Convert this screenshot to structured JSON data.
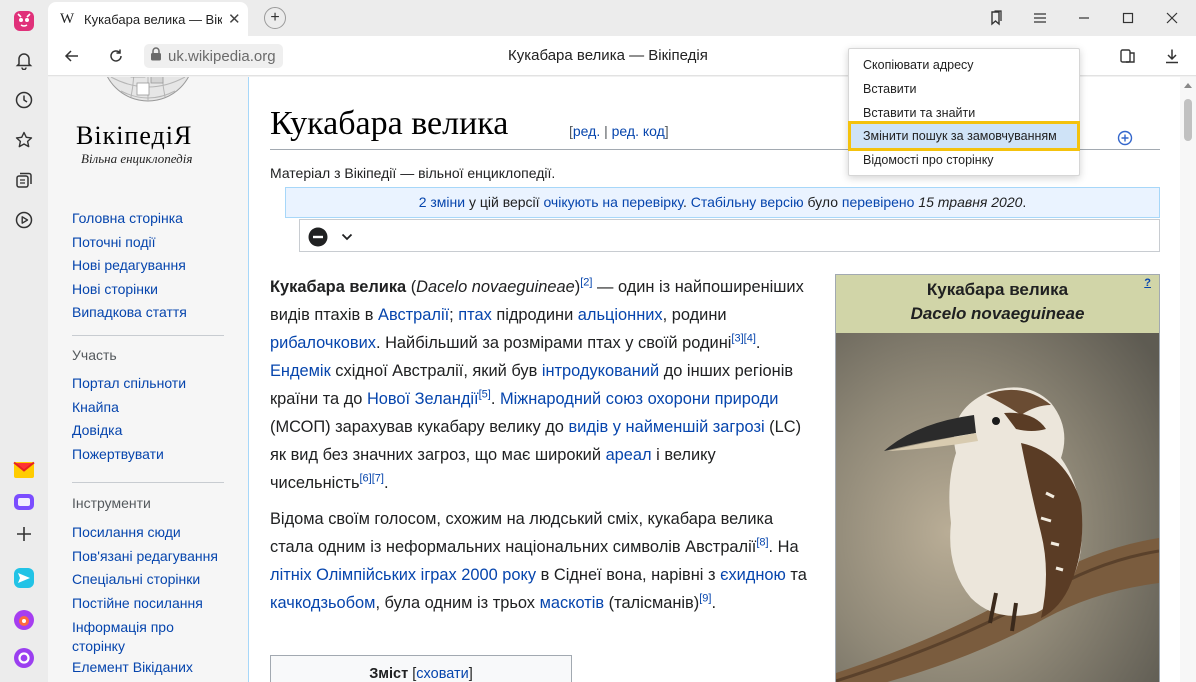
{
  "browser": {
    "tab_title": "Кукабара велика — Вік",
    "tab_favicon": "W",
    "url": "uk.wikipedia.org",
    "page_title": "Кукабара велика — Вікіпедія",
    "accent": "#f4c20d"
  },
  "side_icons": [
    "browser-logo-icon",
    "bell-icon",
    "history-clock-icon",
    "star-icon",
    "collections-icon",
    "play-icon",
    "mail-icon",
    "messenger-icon",
    "add-icon",
    "send-icon",
    "music-icon",
    "alice-icon"
  ],
  "context_menu": {
    "items": [
      "Скопіювати адресу",
      "Вставити",
      "Вставити та знайти",
      "Змінити пошук за замовчуванням",
      "Відомості про сторінку"
    ]
  },
  "wiki_sidebar": {
    "wordmark": "ВікіпедіЯ",
    "tagline": "Вільна енциклопедія",
    "main_links": [
      "Головна сторінка",
      "Поточні події",
      "Нові редагування",
      "Нові сторінки",
      "Випадкова стаття"
    ],
    "participation_heading": "Участь",
    "participation_links": [
      "Портал спільноти",
      "Кнайпа",
      "Довідка",
      "Пожертвувати"
    ],
    "tools_heading": "Інструменти",
    "tools_links": [
      "Посилання сюди",
      "Пов'язані редагування",
      "Спеціальні сторінки",
      "Постійне посилання",
      "Інформація про",
      "сторінку",
      "Елемент Вікіданих"
    ]
  },
  "article": {
    "title": "Кукабара велика",
    "edit_open": "[",
    "edit_link": "ред.",
    "edit_sep": " | ",
    "edit_code_link": "ред. код",
    "edit_close": "]",
    "site_sub": "Матеріал з Вікіпедії — вільної енциклопедії.",
    "review": {
      "changes_link": "2 зміни",
      "t1": " у цій версії ",
      "pending_link": "очікують на перевірку",
      "t2": ". ",
      "stable_link": "Стабільну версію",
      "t3": " було ",
      "checked_link": "перевірено",
      "t4": " ",
      "date": "15 травня 2020",
      "t5": "."
    },
    "p1": {
      "bold": "Кукабара велика",
      "t1": " (",
      "sci": "Dacelo novaeguineae",
      "t2": ")",
      "ref2": "[2]",
      "t3": " — один із найпоширеніших видів птахів в ",
      "l_australia": "Австралії",
      "t4": "; ",
      "l_birds": "птах",
      "t5": " підродини ",
      "l_alcedinidae": "альціонних",
      "t6": ", родини ",
      "l_kingfishers": "рибалочкових",
      "t7": ". Найбільший за розмірами птах у своїй родині",
      "ref3": "[3]",
      "ref4": "[4]",
      "t8": ". ",
      "l_endemic": "Ендемік",
      "t9": " східної Австралії, який був ",
      "l_introduced": "інтродукований",
      "t10": " до інших регіонів країни та до ",
      "l_nz": "Нової Зеландії",
      "ref5": "[5]",
      "t11": ". ",
      "l_iucn": "Міжнародний союз охорони природи",
      "t12": " (МСОП) зарахував кукабару велику до ",
      "l_lc": "видів у найменшій загрозі",
      "t13": " (LC) як вид без значних загроз, що має широкий ",
      "l_range": "ареал",
      "t14": " і велику чисельність",
      "ref6": "[6]",
      "ref7": "[7]",
      "t15": "."
    },
    "p2": {
      "t1": "Відома своїм голосом, схожим на людський сміх, кукабара велика стала одним із неформальних національних символів Австралії",
      "ref8": "[8]",
      "t2": ". На ",
      "l_olympics": "літніх Олімпійських іграх 2000 року",
      "t3": " в Сіднеї вона, нарівні з ",
      "l_echidna": "єхидною",
      "t4": " та ",
      "l_platypus": "качкодзьобом",
      "t5": ", була одним із трьох ",
      "l_mascots": "маскотів",
      "t6": " (талісманів)",
      "ref9": "[9]",
      "t7": "."
    },
    "toc": {
      "title": "Зміст",
      "hide_open": " [",
      "hide_link": "сховати",
      "hide_close": "]"
    }
  },
  "infobox": {
    "title": "Кукабара велика",
    "scientific_name": "Dacelo novaeguineae",
    "help": "?"
  }
}
